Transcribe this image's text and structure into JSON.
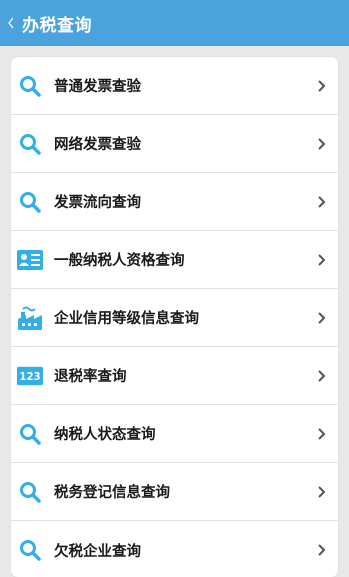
{
  "header": {
    "title": "办税查询"
  },
  "items": [
    {
      "label": "普通发票查验",
      "icon": "search-icon"
    },
    {
      "label": "网络发票查验",
      "icon": "search-icon"
    },
    {
      "label": "发票流向查询",
      "icon": "search-icon"
    },
    {
      "label": "一般纳税人资格查询",
      "icon": "id-card-icon"
    },
    {
      "label": "企业信用等级信息查询",
      "icon": "factory-icon"
    },
    {
      "label": "退税率查询",
      "icon": "123-icon"
    },
    {
      "label": "纳税人状态查询",
      "icon": "search-icon"
    },
    {
      "label": "税务登记信息查询",
      "icon": "search-icon"
    },
    {
      "label": "欠税企业查询",
      "icon": "search-icon"
    }
  ],
  "colors": {
    "header": "#4aa3dc",
    "icon": "#34aee6"
  }
}
